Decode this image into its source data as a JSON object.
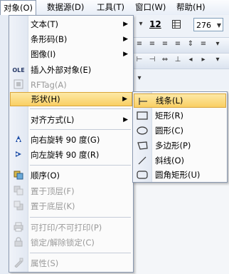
{
  "menubar": {
    "items": [
      "对象(O)",
      "数据源(D)",
      "工具(T)",
      "窗口(W)",
      "帮助(H)"
    ]
  },
  "toolbar": {
    "font_size": "12",
    "zoom_value": "276"
  },
  "menu": {
    "items": [
      {
        "label": "文本(T)",
        "submenu": true,
        "enabled": true,
        "icon": ""
      },
      {
        "label": "条形码(B)",
        "submenu": true,
        "enabled": true,
        "icon": ""
      },
      {
        "label": "图像(I)",
        "submenu": true,
        "enabled": true,
        "icon": ""
      },
      {
        "label": "插入外部对象(E)",
        "submenu": false,
        "enabled": true,
        "icon": "ole-icon"
      },
      {
        "label": "RFTag(A)",
        "submenu": false,
        "enabled": false,
        "icon": "rftag-icon"
      },
      {
        "label": "形状(H)",
        "submenu": true,
        "enabled": true,
        "icon": "",
        "highlighted": true
      },
      {
        "label": "对齐方式(L)",
        "submenu": true,
        "enabled": true,
        "icon": ""
      },
      {
        "label": "向右旋转 90 度(G)",
        "submenu": false,
        "enabled": true,
        "icon": "rotate-right-icon"
      },
      {
        "label": "向左旋转 90 度(R)",
        "submenu": false,
        "enabled": true,
        "icon": "rotate-left-icon"
      },
      {
        "label": "顺序(O)",
        "submenu": false,
        "enabled": true,
        "icon": "order-icon"
      },
      {
        "label": "置于顶层(F)",
        "submenu": false,
        "enabled": false,
        "icon": "bring-front-icon"
      },
      {
        "label": "置于底层(K)",
        "submenu": false,
        "enabled": false,
        "icon": "send-back-icon"
      },
      {
        "label": "可打印/不可打印(P)",
        "submenu": false,
        "enabled": false,
        "icon": "printer-icon"
      },
      {
        "label": "锁定/解除锁定(C)",
        "submenu": false,
        "enabled": false,
        "icon": "lock-icon"
      },
      {
        "label": "属性(S)",
        "submenu": false,
        "enabled": false,
        "icon": "properties-icon"
      }
    ],
    "ole_text": "OLE"
  },
  "submenu": {
    "items": [
      {
        "label": "线条(L)",
        "icon": "line-icon",
        "highlighted": true
      },
      {
        "label": "矩形(R)",
        "icon": "rectangle-icon"
      },
      {
        "label": "圆形(C)",
        "icon": "ellipse-icon"
      },
      {
        "label": "多边形(P)",
        "icon": "polygon-icon"
      },
      {
        "label": "斜线(O)",
        "icon": "diagonal-line-icon"
      },
      {
        "label": "圆角矩形(U)",
        "icon": "rounded-rectangle-icon"
      }
    ]
  },
  "colors": {
    "highlight_top": "#fde9a6",
    "highlight_bottom": "#f9cf63",
    "menu_border": "#8a99b0"
  }
}
